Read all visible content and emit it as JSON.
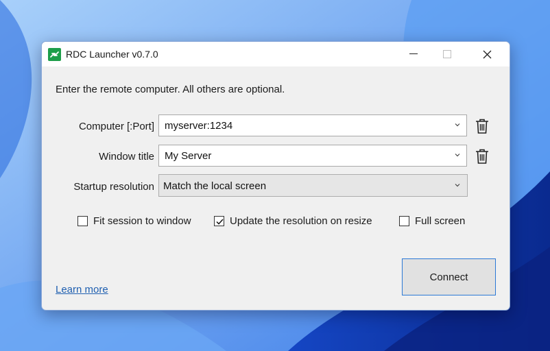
{
  "window": {
    "title": "RDC Launcher v0.7.0",
    "instruction": "Enter the remote computer. All others are optional."
  },
  "form": {
    "computer": {
      "label": "Computer [:Port]",
      "value": "myserver:1234"
    },
    "window_title": {
      "label": "Window title",
      "value": "My Server"
    },
    "startup_resolution": {
      "label": "Startup resolution",
      "value": "Match the local screen"
    }
  },
  "options": {
    "fit_session": {
      "label": "Fit session to window",
      "checked": false
    },
    "update_resolution": {
      "label": "Update the resolution on resize",
      "checked": true
    },
    "full_screen": {
      "label": "Full screen",
      "checked": false
    }
  },
  "footer": {
    "learn_more": "Learn more",
    "connect": "Connect"
  },
  "colors": {
    "accent": "#2a78d6",
    "link": "#1f5fb0",
    "app_icon": "#1e9e4a"
  },
  "icons": {
    "app": "rdc-launcher-icon",
    "minimize": "minimize-icon",
    "maximize": "maximize-icon",
    "close": "close-icon",
    "dropdown": "chevron-down-icon",
    "delete": "trash-icon",
    "check": "checkmark-icon"
  }
}
